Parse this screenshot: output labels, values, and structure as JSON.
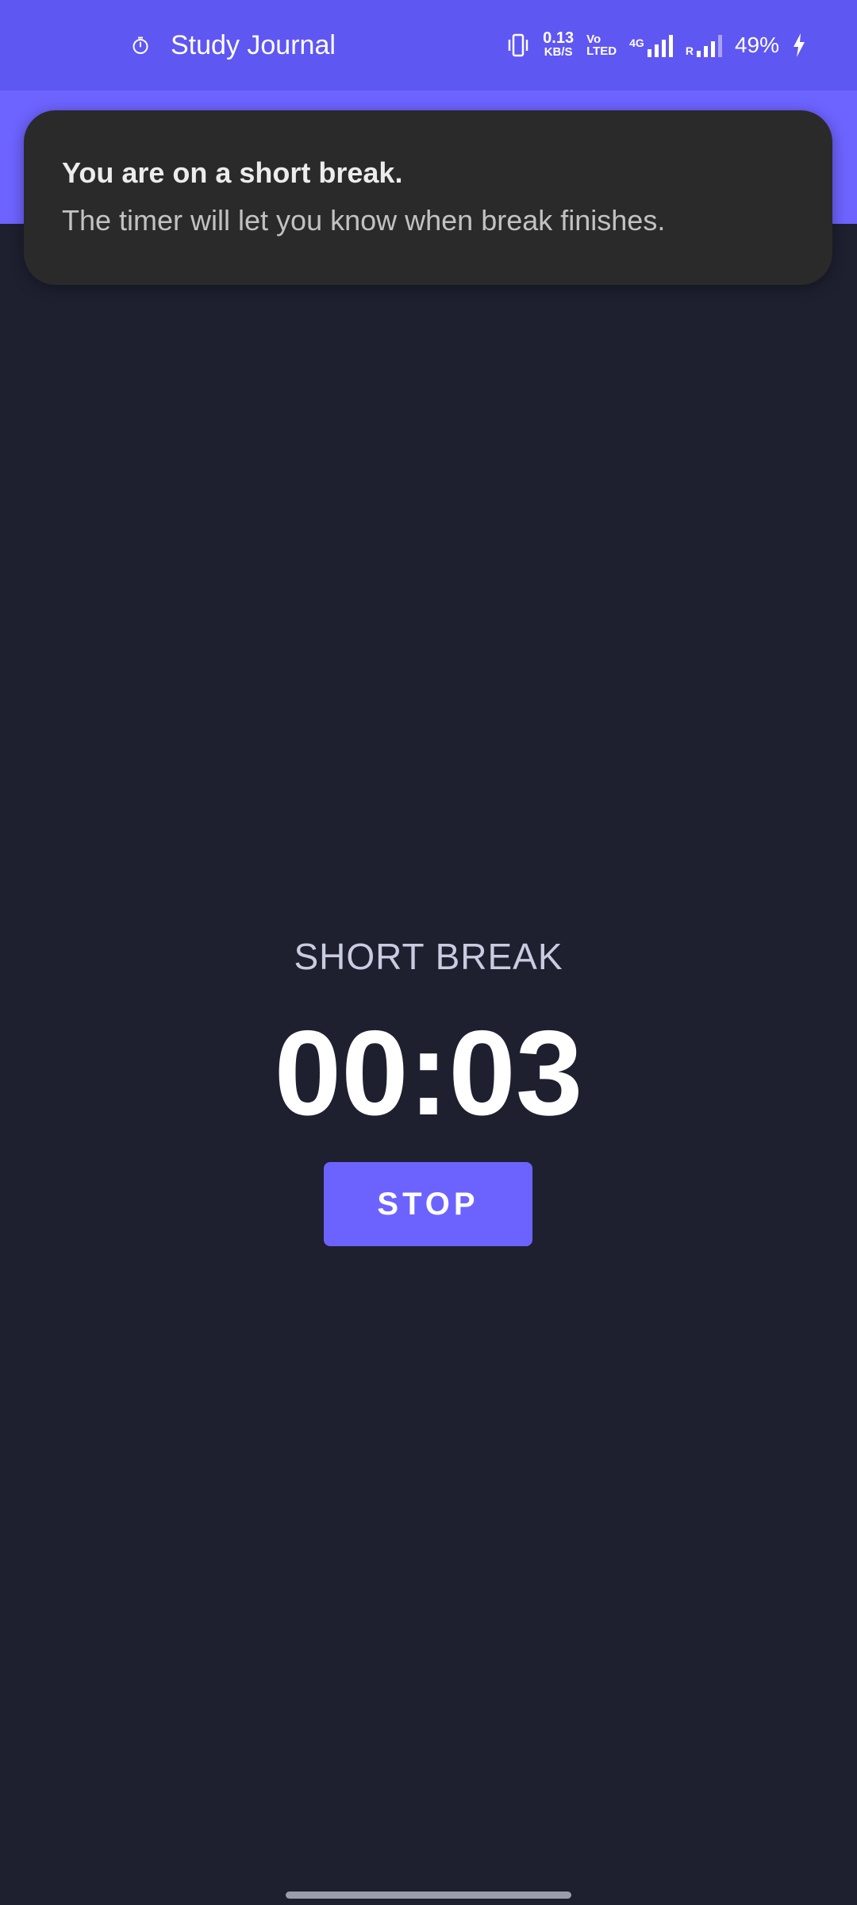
{
  "status_bar": {
    "app_icon": "stopwatch-icon",
    "app_name": "Study Journal",
    "vibrate_icon": "vibrate-icon",
    "net_speed_value": "0.13",
    "net_speed_unit": "KB/S",
    "volte_top": "Vo",
    "volte_bottom": "LTED",
    "sim1_tag": "4G",
    "sim2_tag": "R",
    "battery": "49%",
    "charging_icon": "bolt-icon"
  },
  "colors": {
    "status_bar": "#5f57f2",
    "app_bar": "#6d63ff",
    "background": "#1e2030",
    "toast": "#2a2a2a",
    "accent": "#6c63ff"
  },
  "toast": {
    "title": "You are on a short break.",
    "message": "The timer will let you know when break finishes."
  },
  "timer": {
    "mode": "SHORT BREAK",
    "time": "00:03",
    "stop_label": "STOP"
  }
}
